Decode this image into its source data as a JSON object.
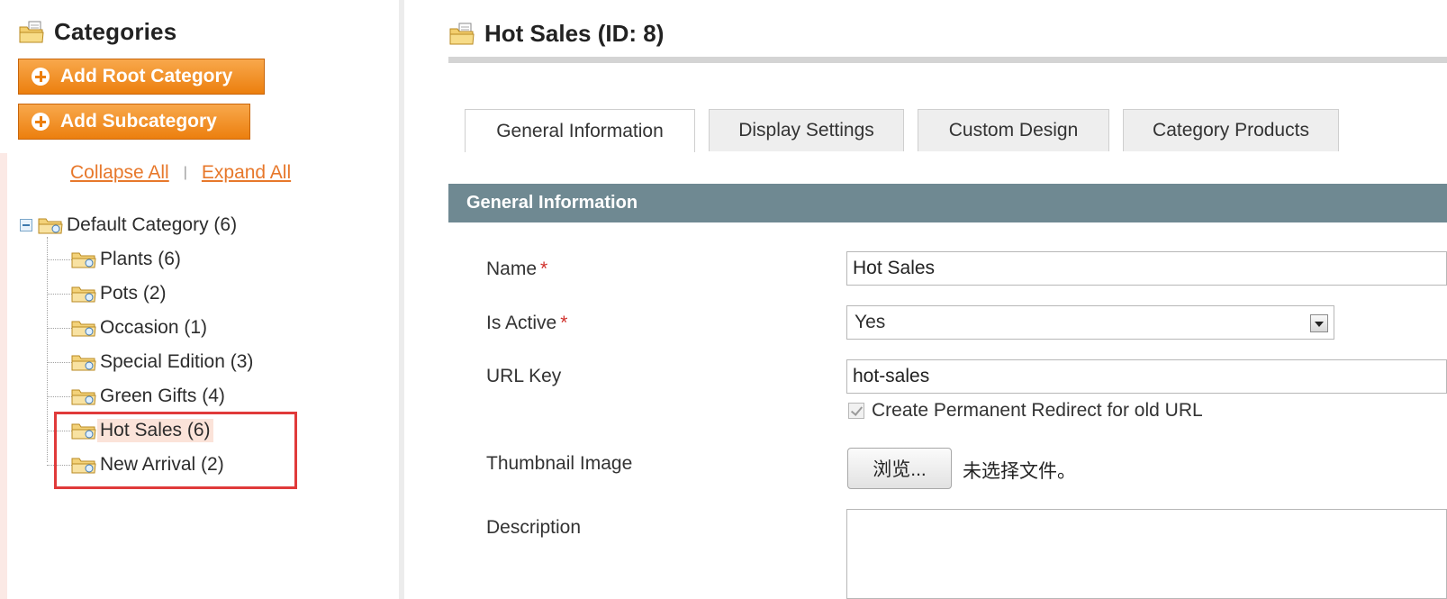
{
  "sidebar": {
    "title": "Categories",
    "add_root_label": "Add Root Category",
    "add_sub_label": "Add Subcategory",
    "collapse_all": "Collapse All",
    "separator": "|",
    "expand_all": "Expand All",
    "tree": {
      "root": "Default Category (6)",
      "children": [
        {
          "label": "Plants (6)",
          "selected": false
        },
        {
          "label": "Pots (2)",
          "selected": false
        },
        {
          "label": "Occasion (1)",
          "selected": false
        },
        {
          "label": "Special Edition (3)",
          "selected": false
        },
        {
          "label": "Green Gifts (4)",
          "selected": false
        },
        {
          "label": "Hot Sales (6)",
          "selected": true
        },
        {
          "label": "New Arrival (2)",
          "selected": false
        }
      ]
    }
  },
  "main": {
    "title": "Hot Sales (ID: 8)",
    "tabs": [
      {
        "label": "General Information",
        "active": true
      },
      {
        "label": "Display Settings",
        "active": false
      },
      {
        "label": "Custom Design",
        "active": false
      },
      {
        "label": "Category Products",
        "active": false
      }
    ],
    "section_title": "General Information",
    "form": {
      "name_label": "Name",
      "name_value": "Hot Sales",
      "is_active_label": "Is Active",
      "is_active_value": "Yes",
      "url_key_label": "URL Key",
      "url_key_value": "hot-sales",
      "redirect_checkbox_label": "Create Permanent Redirect for old URL",
      "thumbnail_label": "Thumbnail Image",
      "browse_label": "浏览...",
      "no_file_text": "未选择文件。",
      "description_label": "Description",
      "required_mark": "*"
    }
  },
  "colors": {
    "accent_orange": "#ec7f0e",
    "section_bar": "#6f8992",
    "link": "#e7782b",
    "highlight_border": "#e03a3a",
    "selected_bg": "#fbe3d9"
  }
}
